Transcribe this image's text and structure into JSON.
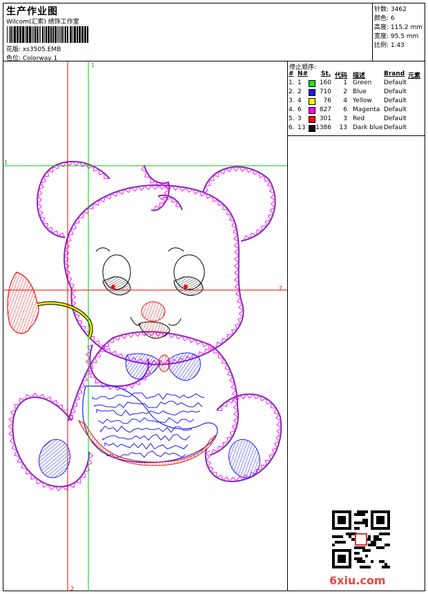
{
  "header": {
    "title": "生产作业图",
    "company": "Wilcom(汇索) 绣饰工作室",
    "design_label": "花版:",
    "design_name": "xs3505.EMB",
    "colorway_label": "色位:",
    "colorway_name": "Colorway 1"
  },
  "stats": {
    "stitches": "针数: 3462",
    "colors": "颜色: 6",
    "height": "高度: 115.2 mm",
    "width": "宽度: 95.5 mm",
    "scale": "比例: 1.43"
  },
  "guides": {
    "v1_label": "1",
    "h1_label": "1",
    "h2_label": "2",
    "v2_label": "2"
  },
  "stop_sequence": {
    "title": "停止顺序:",
    "headers": [
      "#",
      "N#",
      "St.",
      "代码",
      "描述",
      "Brand",
      "元素"
    ],
    "rows": [
      {
        "idx": "1.",
        "n": "1",
        "color": "#22dd22",
        "st": "160",
        "code": "1",
        "desc": "Green",
        "brand": "Default"
      },
      {
        "idx": "2.",
        "n": "2",
        "color": "#1a1aff",
        "st": "710",
        "code": "2",
        "desc": "Blue",
        "brand": "Default"
      },
      {
        "idx": "3.",
        "n": "4",
        "color": "#ffff00",
        "st": "76",
        "code": "4",
        "desc": "Yellow",
        "brand": "Default"
      },
      {
        "idx": "4.",
        "n": "6",
        "color": "#ff00ff",
        "st": "827",
        "code": "6",
        "desc": "Magenta",
        "brand": "Default"
      },
      {
        "idx": "5.",
        "n": "3",
        "color": "#ee1111",
        "st": "301",
        "code": "3",
        "desc": "Red",
        "brand": "Default"
      },
      {
        "idx": "6.",
        "n": "13",
        "color": "#111111",
        "st": "1386",
        "code": "13",
        "desc": "Dark blue",
        "brand": "Default"
      }
    ]
  },
  "watermark": "6xiu.com",
  "colors": {
    "guide_red": "#ee0000",
    "guide_green": "#00cc00",
    "outline_purple": "#7a2bb5",
    "zigzag_magenta": "#ff00ff",
    "blue_fill": "#1a1aff",
    "red_fill": "#ee1111",
    "yellow_stem": "#e8e800"
  }
}
